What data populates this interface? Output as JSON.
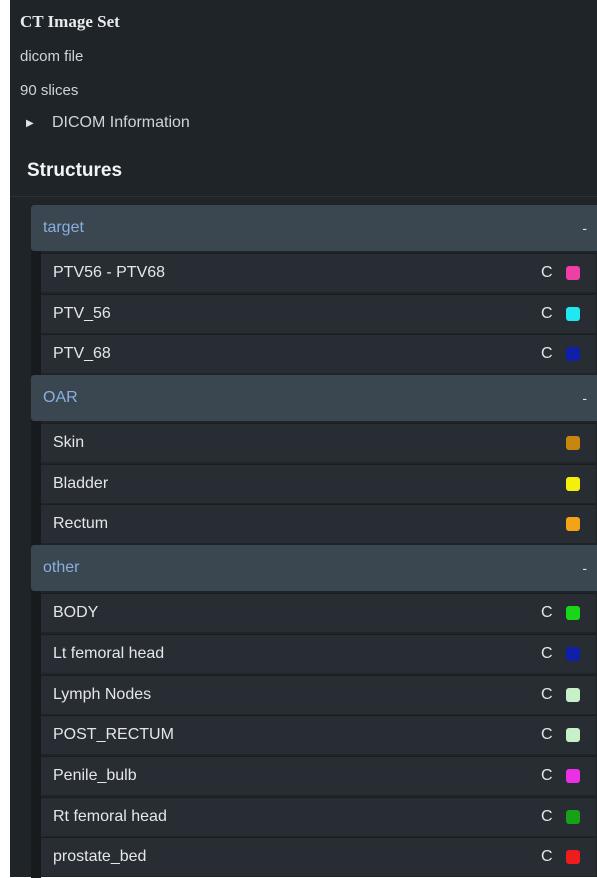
{
  "header": {
    "title": "CT Image Set",
    "file_type": "dicom file",
    "slices": "90 slices",
    "dicom_toggle": "DICOM Information"
  },
  "structures": {
    "heading": "Structures",
    "groups": [
      {
        "name": "target",
        "collapse": "-",
        "items": [
          {
            "name": "PTV56 - PTV68",
            "c": "C",
            "color": "#ee3fa6"
          },
          {
            "name": "PTV_56",
            "c": "C",
            "color": "#20e8f0"
          },
          {
            "name": "PTV_68",
            "c": "C",
            "color": "#0f1fa8"
          }
        ]
      },
      {
        "name": "OAR",
        "collapse": "-",
        "items": [
          {
            "name": "Skin",
            "c": "",
            "color": "#c8860f"
          },
          {
            "name": "Bladder",
            "c": "",
            "color": "#f5f00a"
          },
          {
            "name": "Rectum",
            "c": "",
            "color": "#f2a316"
          }
        ]
      },
      {
        "name": "other",
        "collapse": "-",
        "items": [
          {
            "name": "BODY",
            "c": "C",
            "color": "#19d619"
          },
          {
            "name": "Lt femoral head",
            "c": "C",
            "color": "#0f1fa8"
          },
          {
            "name": "Lymph Nodes",
            "c": "C",
            "color": "#c8f0c8"
          },
          {
            "name": "POST_RECTUM",
            "c": "C",
            "color": "#c8f0c8"
          },
          {
            "name": "Penile_bulb",
            "c": "C",
            "color": "#ec2fe4"
          },
          {
            "name": "Rt femoral head",
            "c": "C",
            "color": "#17a117"
          },
          {
            "name": "prostate_bed",
            "c": "C",
            "color": "#ee1c1c"
          }
        ]
      }
    ]
  }
}
